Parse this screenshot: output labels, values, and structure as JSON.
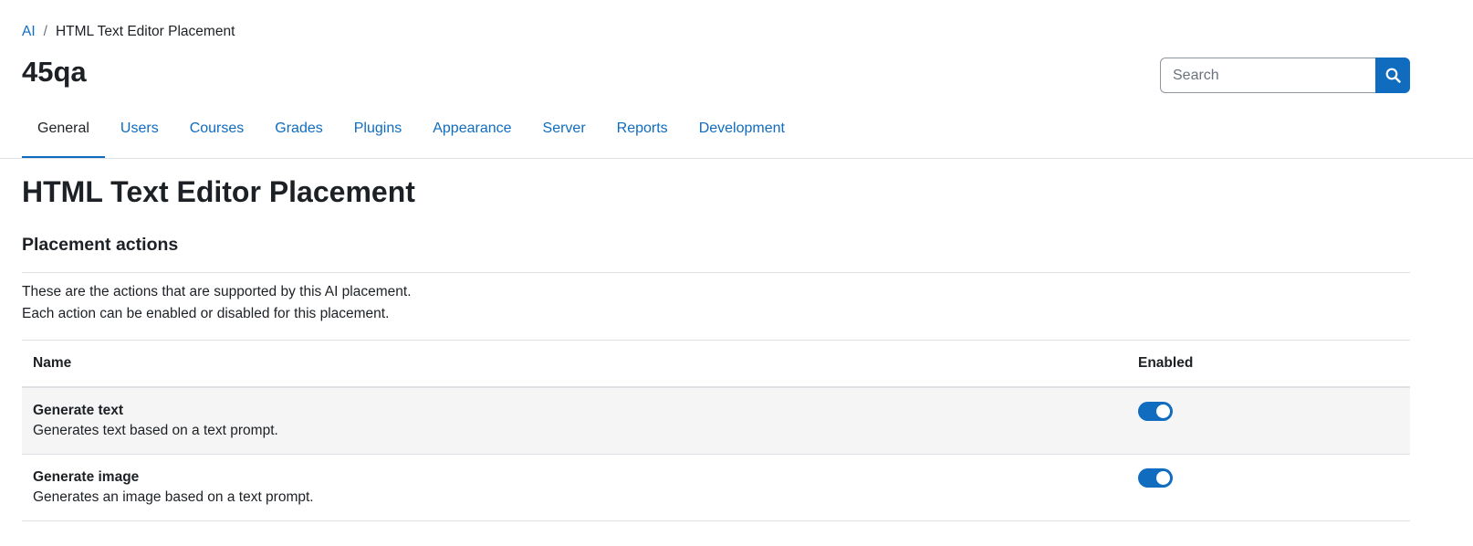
{
  "breadcrumb": {
    "parent": "AI",
    "separator": "/",
    "current": "HTML Text Editor Placement"
  },
  "site": {
    "title": "45qa"
  },
  "search": {
    "placeholder": "Search",
    "icon": "search-icon"
  },
  "nav": {
    "tabs": [
      {
        "label": "General",
        "active": true
      },
      {
        "label": "Users"
      },
      {
        "label": "Courses"
      },
      {
        "label": "Grades"
      },
      {
        "label": "Plugins"
      },
      {
        "label": "Appearance"
      },
      {
        "label": "Server"
      },
      {
        "label": "Reports"
      },
      {
        "label": "Development"
      }
    ]
  },
  "page": {
    "heading": "HTML Text Editor Placement",
    "section_heading": "Placement actions",
    "description_line1": "These are the actions that are supported by this AI placement.",
    "description_line2": "Each action can be enabled or disabled for this placement."
  },
  "table": {
    "col_name": "Name",
    "col_enabled": "Enabled",
    "rows": [
      {
        "title": "Generate text",
        "description": "Generates text based on a text prompt.",
        "enabled": true
      },
      {
        "title": "Generate image",
        "description": "Generates an image based on a text prompt.",
        "enabled": true
      }
    ]
  },
  "colors": {
    "accent": "#0f6cbf",
    "text": "#1d2125",
    "row_stripe": "#f5f5f5",
    "divider": "#dee2e6"
  }
}
